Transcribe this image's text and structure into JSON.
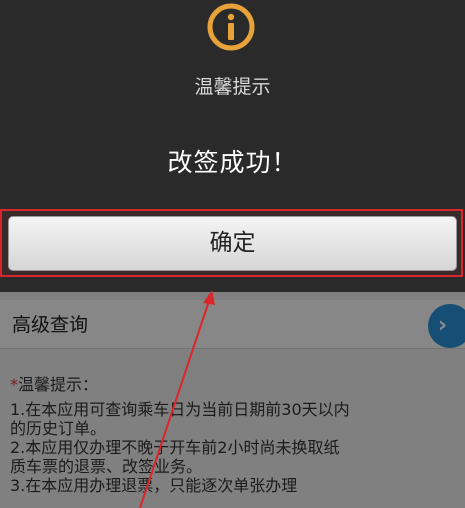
{
  "dialog": {
    "icon": "info-icon",
    "title": "温馨提示",
    "message": "改签成功！",
    "ok_label": "确定",
    "accent_color": "#e8a23a",
    "highlight_color": "#d9262b"
  },
  "background": {
    "advanced_query_label": "高级查询",
    "advanced_query_icon": "chevron-right-icon",
    "tips_star": "*",
    "tips_title": "温馨提示：",
    "tips": [
      "1.在本应用可查询乘车日为当前日期前30天以内",
      "的历史订单。",
      "2.本应用仅办理不晚于开车前2小时尚未换取纸",
      "质车票的退票、改签业务。",
      "3.在本应用办理退票，只能逐次单张办理"
    ]
  }
}
